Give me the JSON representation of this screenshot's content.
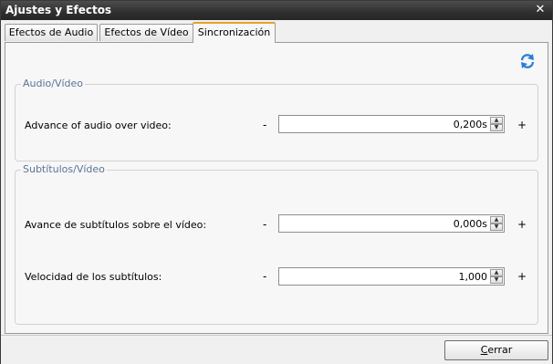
{
  "window": {
    "title": "Ajustes y Efectos",
    "close_glyph": "✕"
  },
  "tabs": [
    {
      "label": "Efectos de Audio"
    },
    {
      "label": "Efectos de Vídeo"
    },
    {
      "label": "Sincronización",
      "active": true
    }
  ],
  "refresh_icon": "refresh-icon",
  "audio_group": {
    "title": "Audio/Vídeo",
    "rows": [
      {
        "label": "Advance of audio over video:",
        "value": "0,200s",
        "minus": "-",
        "plus": "+"
      }
    ]
  },
  "subs_group": {
    "title": "Subtítulos/Vídeo",
    "rows": [
      {
        "label": "Avance de subtítulos sobre el vídeo:",
        "value": "0,000s",
        "minus": "-",
        "plus": "+"
      },
      {
        "label": "Velocidad de los subtítulos:",
        "value": "1,000",
        "minus": "-",
        "plus": "+"
      }
    ]
  },
  "footer": {
    "close_label_first": "C",
    "close_label_rest": "errar"
  },
  "colors": {
    "accent_tab": "#e8a12a",
    "group_title": "#5a7596",
    "refresh_blue": "#2a7fd4"
  }
}
